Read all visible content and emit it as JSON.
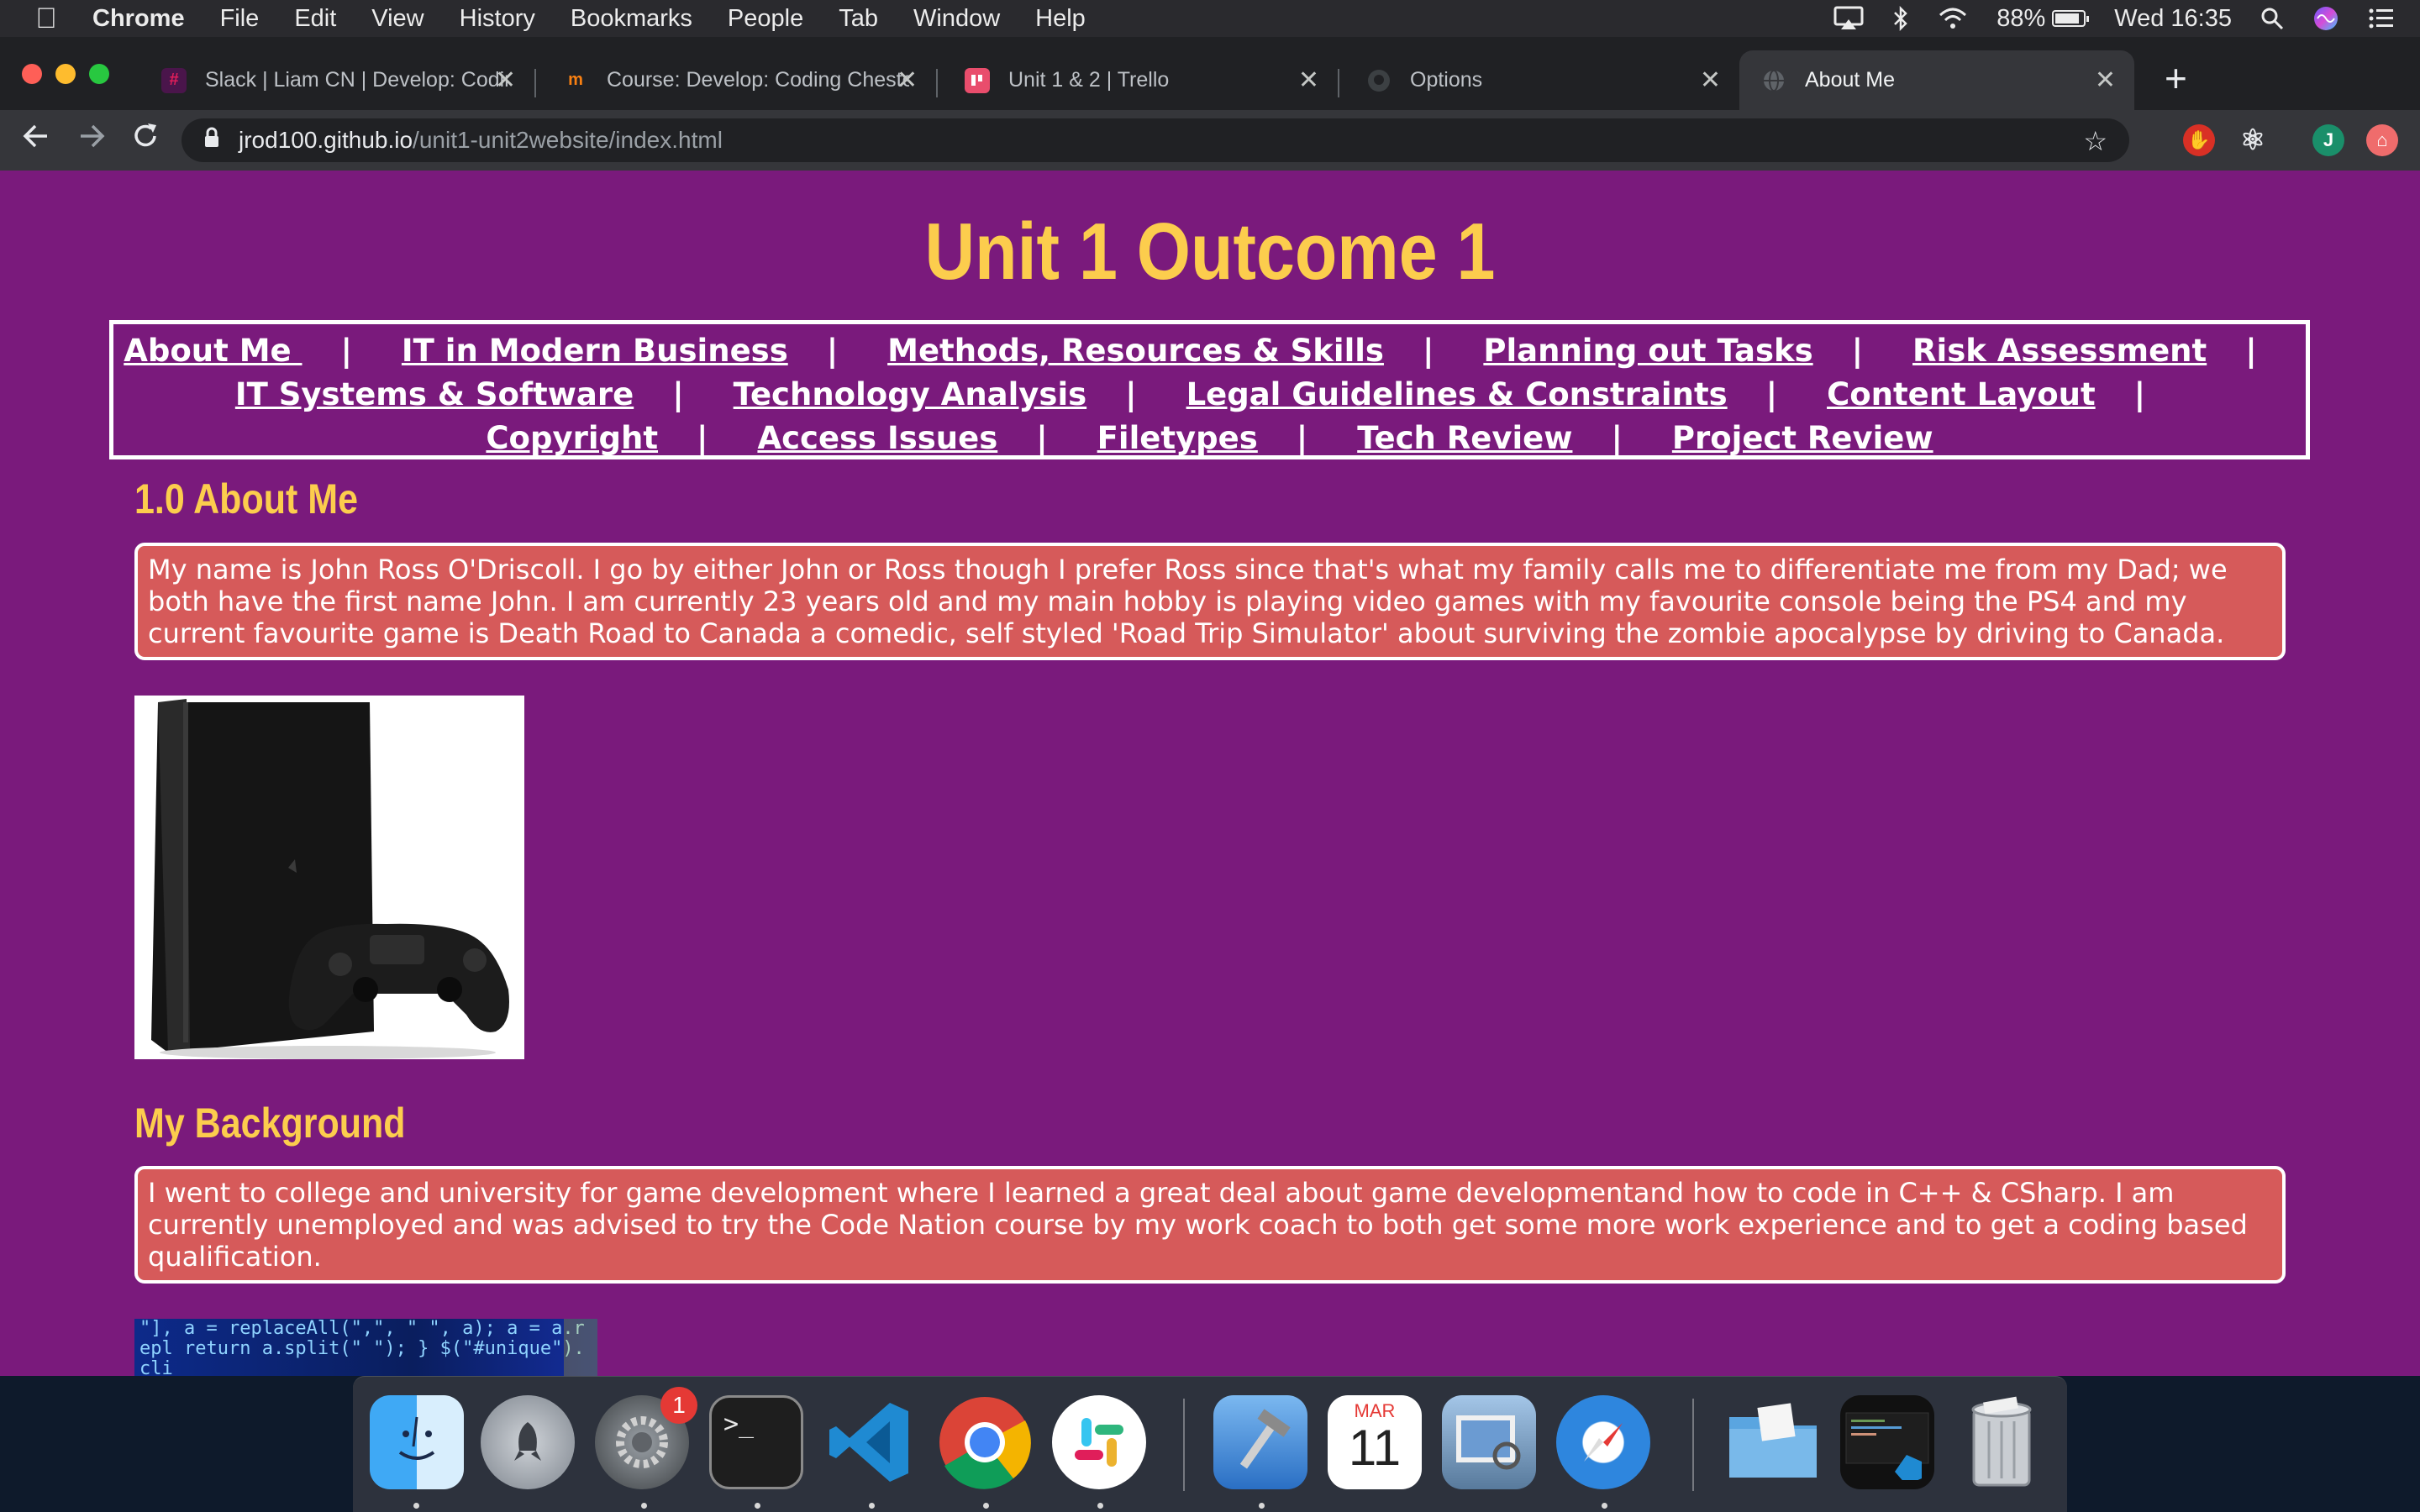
{
  "menubar": {
    "app": "Chrome",
    "items": [
      "File",
      "Edit",
      "View",
      "History",
      "Bookmarks",
      "People",
      "Tab",
      "Window",
      "Help"
    ],
    "battery": "88%",
    "clock": "Wed 16:35",
    "battery_level": 0.88
  },
  "tabs": [
    {
      "title": "Slack | Liam CN | Develop: Codin",
      "icon": "slack-icon"
    },
    {
      "title": "Course: Develop: Coding Cheste",
      "icon": "moodle-icon"
    },
    {
      "title": "Unit 1 & 2 | Trello",
      "icon": "trello-icon"
    },
    {
      "title": "Options",
      "icon": "github-icon"
    },
    {
      "title": "About Me",
      "icon": "globe-icon"
    }
  ],
  "omnibox": {
    "host": "jrod100.github.io",
    "path": "/unit1-unit2website/index.html"
  },
  "page": {
    "heading": "Unit 1 Outcome 1",
    "nav": [
      "About Me ",
      "IT in Modern Business",
      "Methods, Resources & Skills",
      "Planning out Tasks",
      "Risk Assessment",
      "IT Systems & Software",
      "Technology Analysis",
      "Legal Guidelines & Constraints",
      "Content Layout",
      "Copyright",
      "Access Issues",
      "Filetypes",
      "Tech Review",
      "Project Review"
    ],
    "nav_separator": "|",
    "section1_title": "1.0 About Me",
    "section1_text": "My name is John Ross O'Driscoll. I go by either John or Ross though I prefer Ross since that's what my family calls me to differentiate me from my Dad; we both have the first name John. I am currently 23 years old and my main hobby is playing video games with my favourite console being the PS4 and my current favourite game is Death Road to Canada a comedic, self styled 'Road Trip Simulator' about surviving the zombie apocalypse by driving to Canada.",
    "section2_title": "My Background",
    "section2_text": "I went to college and university for game development where I learned a great deal about game developmentand how to code in C++ & CSharp. I am currently unemployed and was advised to try the Code Nation course by my work coach to both get some more work experience and to get a coding based qualification.",
    "code_snippet": "\"], a = replaceAll(\",\", \" \", a); a = a.repl return a.split(\" \"); } $(\"#unique\").cli"
  },
  "dock": {
    "calendar_month": "MAR",
    "calendar_day": "11",
    "settings_badge": "1",
    "terminal_prompt": ">_"
  }
}
